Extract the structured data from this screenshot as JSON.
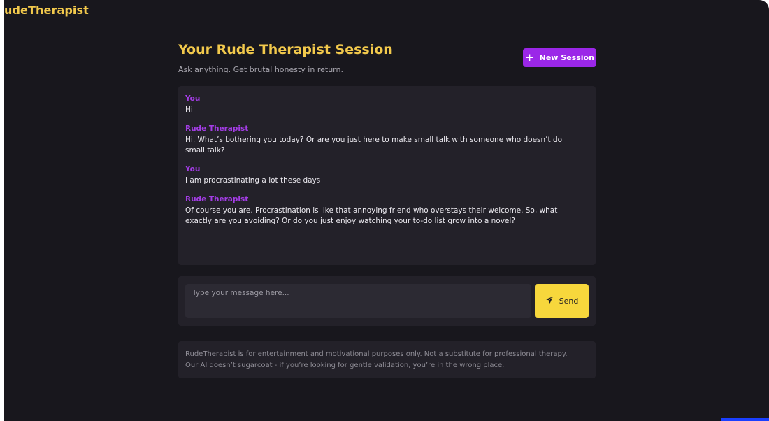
{
  "app": {
    "brand": "udeTherapist"
  },
  "header": {
    "title": "Your Rude Therapist Session",
    "subtitle": "Ask anything. Get brutal honesty in return.",
    "new_session_label": "New Session",
    "new_session_icon": "plus-icon"
  },
  "chat": {
    "messages": [
      {
        "sender": "You",
        "text": "Hi"
      },
      {
        "sender": "Rude Therapist",
        "text": "Hi. What’s bothering you today? Or are you just here to make small talk with someone who doesn’t do small talk?"
      },
      {
        "sender": "You",
        "text": "I am procrastinating a lot these days"
      },
      {
        "sender": "Rude Therapist",
        "text": "Of course you are. Procrastination is like that annoying friend who overstays their welcome. So, what exactly are you avoiding? Or do you just enjoy watching your to-do list grow into a novel?"
      }
    ]
  },
  "composer": {
    "placeholder": "Type your message here...",
    "value": "",
    "send_label": "Send",
    "send_icon": "paper-plane-icon"
  },
  "disclaimer": {
    "line1": "RudeTherapist is for entertainment and motivational purposes only. Not a substitute for professional therapy.",
    "line2": "Our AI doesn’t sugarcoat - if you’re looking for gentle validation, you’re in the wrong place."
  },
  "colors": {
    "background": "#18171d",
    "panel": "#232129",
    "accent_yellow": "#f2c94c",
    "accent_purple": "#9b27e8",
    "send_yellow": "#f7d73c",
    "sender_label": "#a43de6"
  }
}
